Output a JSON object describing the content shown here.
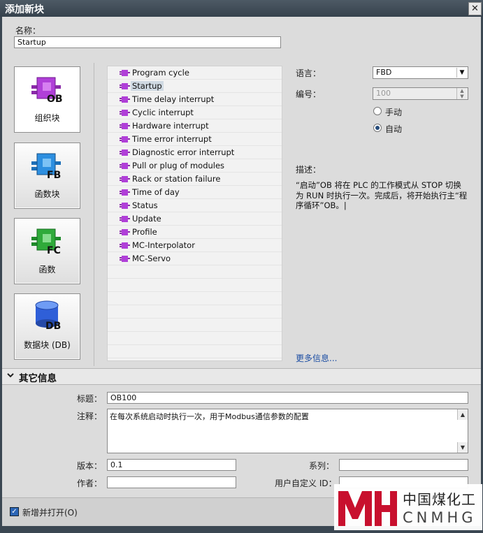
{
  "window": {
    "title": "添加新块",
    "close": "✕"
  },
  "name_section": {
    "label": "名称：",
    "value": "Startup"
  },
  "block_types": [
    {
      "label": "组织块",
      "tag": "OB",
      "color": "#b03fd8"
    },
    {
      "label": "函数块",
      "tag": "FB",
      "color": "#2d8fe0"
    },
    {
      "label": "函数",
      "tag": "FC",
      "color": "#2faa3a"
    },
    {
      "label": "数据块 (DB)",
      "tag": "DB",
      "color": "#2f5fd8"
    }
  ],
  "ob_list": {
    "items": [
      "Program cycle",
      "Startup",
      "Time delay interrupt",
      "Cyclic interrupt",
      "Hardware interrupt",
      "Time error interrupt",
      "Diagnostic error interrupt",
      "Pull or plug of modules",
      "Rack or station failure",
      "Time of day",
      "Status",
      "Update",
      "Profile",
      "MC-Interpolator",
      "MC-Servo"
    ],
    "selected_index": 1
  },
  "properties": {
    "language_label": "语言：",
    "language_value": "FBD",
    "number_label": "编号：",
    "number_value": "100",
    "manual_label": "手动",
    "auto_label": "自动",
    "auto_selected": true
  },
  "description": {
    "label": "描述：",
    "text": "“启动”OB 将在 PLC 的工作模式从 STOP 切换为 RUN 时执行一次。完成后，将开始执行主“程序循环”OB。|",
    "more_link": "更多信息..."
  },
  "other_info": {
    "section_title": "其它信息",
    "title_label": "标题：",
    "title_value": "OB100",
    "comment_label": "注释：",
    "comment_value": "在每次系统启动时执行一次，用于Modbus通信参数的配置",
    "version_label": "版本：",
    "version_value": "0.1",
    "family_label": "系列：",
    "family_value": "",
    "author_label": "作者：",
    "author_value": "",
    "userid_label": "用户自定义 ID：",
    "userid_value": ""
  },
  "footer": {
    "checkbox_label": "新增并打开(O)",
    "checked": true
  },
  "watermark": {
    "cn": "中国煤化工",
    "en": "CNMHG"
  }
}
